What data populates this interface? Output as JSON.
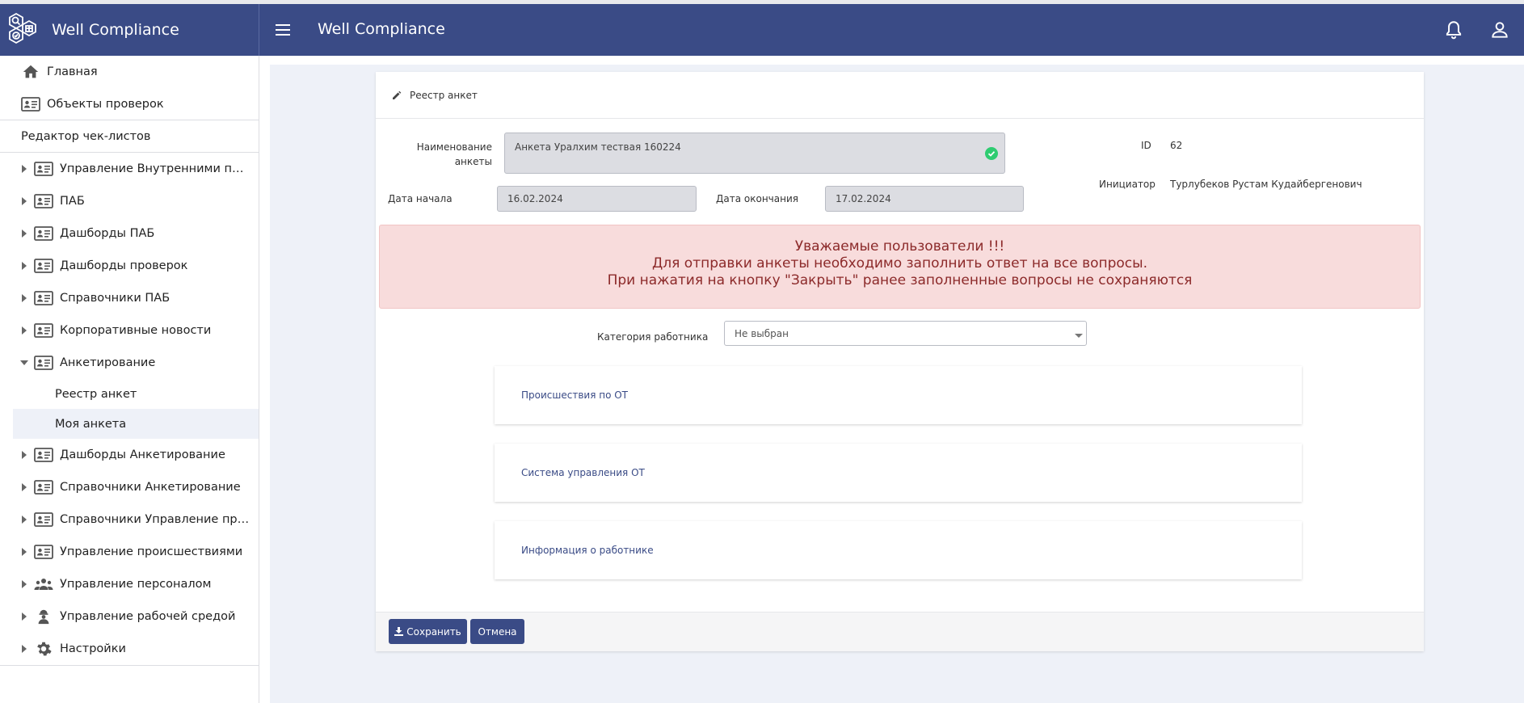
{
  "app": {
    "title": "Well Compliance"
  },
  "header": {
    "page_title": "Well Compliance"
  },
  "sidebar": {
    "top_items": [
      {
        "label": "Главная",
        "icon": "home-icon"
      },
      {
        "label": "Объекты проверок",
        "icon": "id-card-icon"
      }
    ],
    "section_title": "Редактор чек-листов",
    "items": [
      {
        "label": "Управление Внутренними проверками",
        "icon": "id-card-icon",
        "expanded": false
      },
      {
        "label": "ПАБ",
        "icon": "id-card-icon",
        "expanded": false
      },
      {
        "label": "Дашборды ПАБ",
        "icon": "id-card-icon",
        "expanded": false
      },
      {
        "label": "Дашборды проверок",
        "icon": "id-card-icon",
        "expanded": false
      },
      {
        "label": "Справочники ПАБ",
        "icon": "id-card-icon",
        "expanded": false
      },
      {
        "label": "Корпоративные новости",
        "icon": "id-card-icon",
        "expanded": false
      },
      {
        "label": "Анкетирование",
        "icon": "id-card-icon",
        "expanded": true
      },
      {
        "label": "Дашборды Анкетирование",
        "icon": "id-card-icon",
        "expanded": false
      },
      {
        "label": "Справочники Анкетирование",
        "icon": "id-card-icon",
        "expanded": false
      },
      {
        "label": "Справочники Управление происшествиями",
        "icon": "id-card-icon",
        "expanded": false
      },
      {
        "label": "Управление происшествиями",
        "icon": "id-card-icon",
        "expanded": false
      },
      {
        "label": "Управление персоналом",
        "icon": "people-icon",
        "expanded": false
      },
      {
        "label": "Управление рабочей средой",
        "icon": "worker-icon",
        "expanded": false
      },
      {
        "label": "Настройки",
        "icon": "gear-icon",
        "expanded": false
      }
    ],
    "sub_items": [
      {
        "label": "Реестр анкет",
        "active": false
      },
      {
        "label": "Моя анкета",
        "active": true
      }
    ]
  },
  "card": {
    "breadcrumb": "Реестр анкет",
    "form": {
      "name_label": "Наименование анкеты",
      "name_label_line1": "Наименование",
      "name_label_line2": "анкеты",
      "name_value": "Анкета Уралхим тествая 160224",
      "id_label": "ID",
      "id_value": "62",
      "initiator_label": "Инициатор",
      "initiator_value": "Турлубеков Рустам Кудайбергенович",
      "start_label": "Дата начала",
      "start_value": "16.02.2024",
      "end_label": "Дата окончания",
      "end_value": "17.02.2024"
    },
    "alert": {
      "line1": "Уважаемые пользователи !!!",
      "line2": "Для отправки анкеты необходимо заполнить ответ на все вопросы.",
      "line3": "При нажатия на кнопку \"Закрыть\" ранее заполненные вопросы не сохраняются"
    },
    "category": {
      "label": "Категория работника",
      "value": "Не выбран"
    },
    "sections": [
      {
        "label": "Происшествия по ОТ"
      },
      {
        "label": "Система управления ОТ"
      },
      {
        "label": "Информация о работнике"
      }
    ],
    "buttons": {
      "save": "Сохранить",
      "cancel": "Отмена"
    }
  },
  "colors": {
    "brand": "#3a4b86",
    "main_bg": "#eef1f8",
    "alert_bg": "#f8dcdc",
    "alert_text": "#8c2a2a",
    "check_green": "#2ecc71"
  }
}
